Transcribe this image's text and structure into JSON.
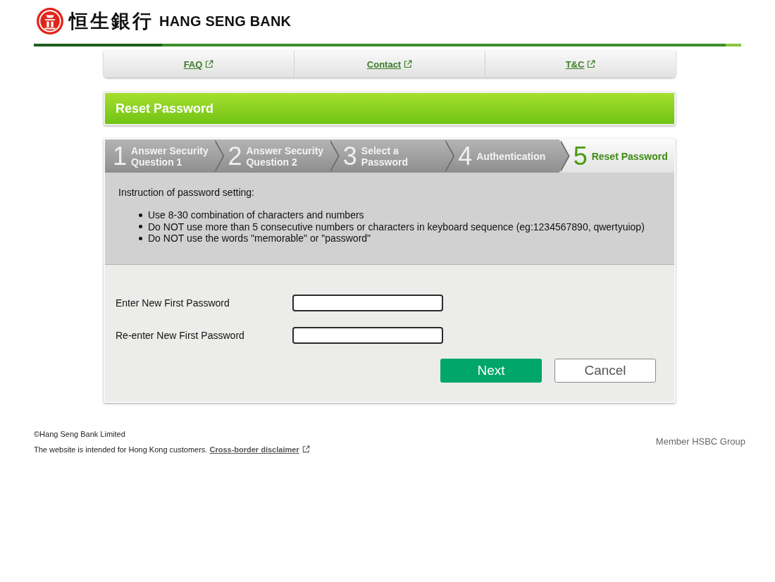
{
  "header": {
    "logo_chinese": "恒生銀行",
    "logo_english": "HANG SENG BANK"
  },
  "nav_links": [
    {
      "label": "FAQ"
    },
    {
      "label": "Contact"
    },
    {
      "label": "T&C"
    }
  ],
  "page_title": "Reset Password",
  "steps": [
    {
      "number": "1",
      "label": "Answer Security Question 1",
      "selected": false
    },
    {
      "number": "2",
      "label": "Answer Security Question 2",
      "selected": false
    },
    {
      "number": "3",
      "label": "Select a Password",
      "selected": false
    },
    {
      "number": "4",
      "label": "Authentication",
      "selected": false
    },
    {
      "number": "5",
      "label": "Reset Password",
      "selected": true
    }
  ],
  "instructions": {
    "heading": "Instruction of password setting:",
    "items": [
      "Use 8-30 combination of characters and numbers",
      "Do NOT use more than 5 consecutive numbers or characters in keyboard sequence (eg:1234567890, qwertyuiop)",
      "Do NOT use the words \"memorable\" or \"password\""
    ]
  },
  "form": {
    "fields": [
      {
        "label": "Enter New First Password"
      },
      {
        "label": "Re-enter New First Password"
      }
    ],
    "buttons": [
      {
        "label": "Next",
        "kind": "primary"
      },
      {
        "label": "Cancel",
        "kind": "secondary"
      }
    ]
  },
  "footer": {
    "copyright": "©Hang Seng Bank Limited",
    "notice": "The website is intended for Hong Kong customers.",
    "disclaimer_link": "Cross-border disclaimer",
    "member": "Member HSBC Group"
  }
}
